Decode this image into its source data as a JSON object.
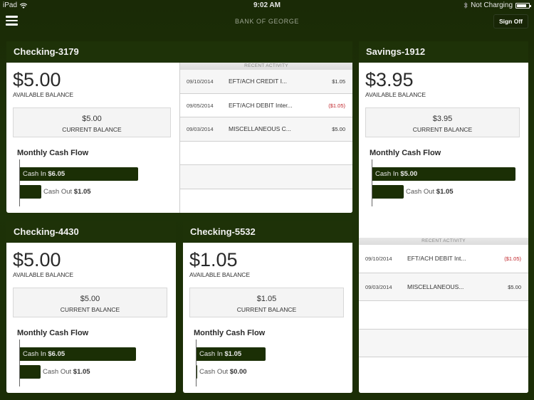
{
  "status_bar": {
    "device": "iPad",
    "time": "9:02 AM",
    "charging": "Not Charging"
  },
  "nav": {
    "brand": "BANK OF GEORGE",
    "sign_off": "Sign Off"
  },
  "labels": {
    "available_balance": "AVAILABLE BALANCE",
    "current_balance": "CURRENT BALANCE",
    "monthly_cash_flow": "Monthly Cash Flow",
    "cash_in": "Cash In",
    "cash_out": "Cash Out",
    "recent_activity": "RECENT ACTIVITY"
  },
  "accounts": [
    {
      "name": "Checking-3179",
      "available": "$5.00",
      "current": "$5.00",
      "cash_in": "$6.05",
      "cash_out": "$1.05",
      "activity": [
        {
          "date": "09/10/2014",
          "desc": "EFT/ACH CREDIT I...",
          "amount": "$1.05",
          "negative": false
        },
        {
          "date": "09/05/2014",
          "desc": "EFT/ACH DEBIT Inter...",
          "amount": "($1.05)",
          "negative": true
        },
        {
          "date": "09/03/2014",
          "desc": "MISCELLANEOUS C...",
          "amount": "$5.00",
          "negative": false
        }
      ]
    },
    {
      "name": "Savings-1912",
      "available": "$3.95",
      "current": "$3.95",
      "cash_in": "$5.00",
      "cash_out": "$1.05",
      "activity": [
        {
          "date": "09/10/2014",
          "desc": "EFT/ACH DEBIT Int...",
          "amount": "($1.05)",
          "negative": true
        },
        {
          "date": "09/03/2014",
          "desc": "MISCELLANEOUS...",
          "amount": "$5.00",
          "negative": false
        }
      ]
    },
    {
      "name": "Checking-4430",
      "available": "$5.00",
      "current": "$5.00",
      "cash_in": "$6.05",
      "cash_out": "$1.05"
    },
    {
      "name": "Checking-5532",
      "available": "$1.05",
      "current": "$1.05",
      "cash_in": "$1.05",
      "cash_out": "$0.00"
    }
  ],
  "colors": {
    "brand_green": "#1e3208",
    "negative": "#c0262b"
  }
}
